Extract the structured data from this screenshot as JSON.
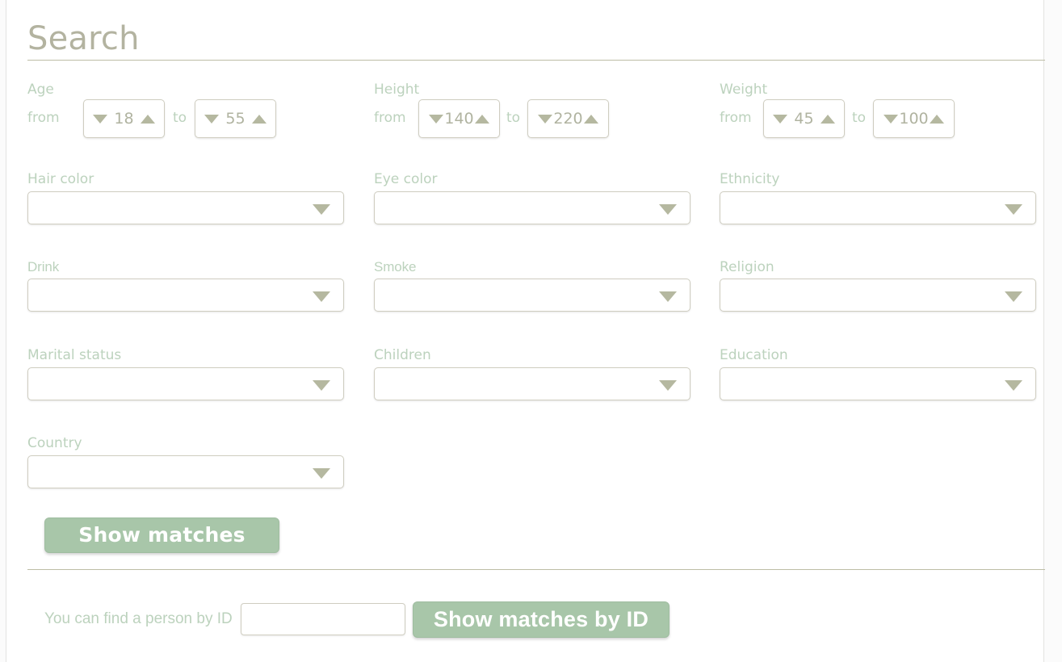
{
  "page": {
    "title": "Search"
  },
  "ranges": [
    {
      "label": "Age",
      "from_word": "from",
      "to_word": "to",
      "from_value": "18",
      "to_value": "55",
      "down_icon": "triangle-down-icon",
      "up_icon": "triangle-up-icon"
    },
    {
      "label": "Height",
      "from_word": "from",
      "to_word": "to",
      "from_value": "140",
      "to_value": "220",
      "down_icon": "triangle-down-icon",
      "up_icon": "triangle-up-icon"
    },
    {
      "label": "Weight",
      "from_word": "from",
      "to_word": "to",
      "from_value": "45",
      "to_value": "100",
      "down_icon": "triangle-down-icon",
      "up_icon": "triangle-up-icon"
    }
  ],
  "selects": [
    {
      "label": "Hair color",
      "value": ""
    },
    {
      "label": "Eye color",
      "value": ""
    },
    {
      "label": "Ethnicity",
      "value": ""
    },
    {
      "label": "Drink",
      "value": ""
    },
    {
      "label": "Smoke",
      "value": ""
    },
    {
      "label": "Religion",
      "value": ""
    },
    {
      "label": "Marital status",
      "value": ""
    },
    {
      "label": "Children",
      "value": ""
    },
    {
      "label": "Education",
      "value": ""
    },
    {
      "label": "Country",
      "value": ""
    }
  ],
  "select_caret_icon": "chevron-down-icon",
  "actions": {
    "show_matches_label": "Show matches",
    "show_matches_by_id_label": "Show matches by ID"
  },
  "id_lookup": {
    "hint": "You can find a person by ID",
    "input_value": "",
    "input_placeholder": ""
  },
  "colors": {
    "label_green": "#bcd2bd",
    "title_gray": "#b3b3a0",
    "button_green": "#a8c6a9",
    "border_tan": "#cfcdc0",
    "rule_tan": "#bdbda6",
    "caret_sage": "#b5b8a0",
    "panel_white": "#ffffff"
  }
}
